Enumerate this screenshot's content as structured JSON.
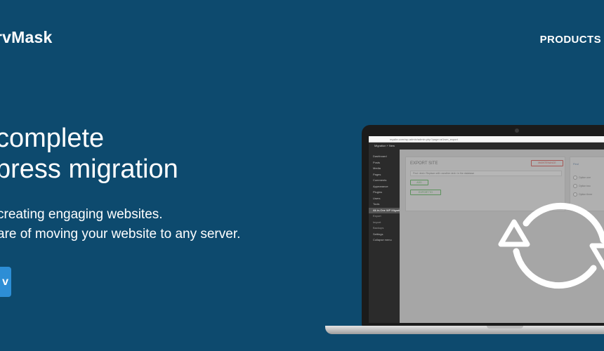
{
  "header": {
    "brand": "rvMask",
    "nav": {
      "products": "PRODUCTS"
    }
  },
  "hero": {
    "title_line1": "complete",
    "title_line2": "press migration",
    "sub_line1": "creating engaging websites.",
    "sub_line2": "are of moving your website to any server.",
    "cta_label": "v"
  },
  "laptop_screen": {
    "browser_url": "mysite.com/wp-admin/admin.php?page=ai1wm_export",
    "wp_topbar": "Migration     + New",
    "sidebar_items": [
      {
        "label": "Dashboard",
        "active": false,
        "sub": false
      },
      {
        "label": "Posts",
        "active": false,
        "sub": false
      },
      {
        "label": "Media",
        "active": false,
        "sub": false
      },
      {
        "label": "Pages",
        "active": false,
        "sub": false
      },
      {
        "label": "Comments",
        "active": false,
        "sub": false
      },
      {
        "label": "Appearance",
        "active": false,
        "sub": false
      },
      {
        "label": "Plugins",
        "active": false,
        "sub": false
      },
      {
        "label": "Users",
        "active": false,
        "sub": false
      },
      {
        "label": "Tools",
        "active": false,
        "sub": false
      },
      {
        "label": "All-in-One WP Migration",
        "active": true,
        "sub": false
      },
      {
        "label": "Export",
        "active": false,
        "sub": true
      },
      {
        "label": "Import",
        "active": false,
        "sub": true
      },
      {
        "label": "Backups",
        "active": false,
        "sub": true
      },
      {
        "label": "Settings",
        "active": false,
        "sub": false
      },
      {
        "label": "Collapse menu",
        "active": false,
        "sub": false
      }
    ],
    "panel_title": "EXPORT SITE",
    "panel_red_button": "MAINTENANCE",
    "panel_row_text": "Find  <text>  Replace with  <another-text>  in the database",
    "panel_btn_add": "ADD",
    "panel_btn_export": "EXPORT TO",
    "side_title": "Find",
    "side_options": [
      "Option one",
      "Option two",
      "Option three"
    ]
  },
  "icons": {
    "sync": "sync-icon"
  },
  "colors": {
    "background": "#0d4a6e",
    "cta": "#2d8ed6",
    "text": "#ffffff"
  }
}
